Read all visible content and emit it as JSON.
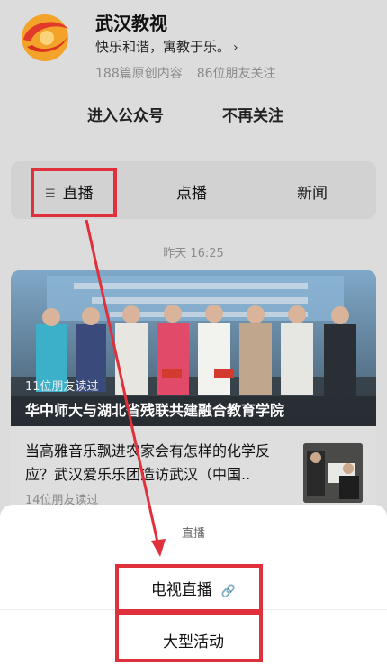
{
  "account": {
    "name": "武汉教视",
    "description": "快乐和谐，寓教于乐。",
    "description_chevron": "›",
    "stats": [
      "188篇原创内容",
      "86位朋友关注"
    ],
    "actions": {
      "enter": "进入公众号",
      "unfollow": "不再关注"
    }
  },
  "tabs": [
    {
      "label": "直播",
      "icon": "menu-icon"
    },
    {
      "label": "点播"
    },
    {
      "label": "新闻"
    }
  ],
  "feed": {
    "timestamp": "昨天 16:25",
    "featured": {
      "readers": "11位朋友读过",
      "title": "华中师大与湖北省残联共建融合教育学院"
    },
    "article": {
      "title": "当高雅音乐飘进农家会有怎样的化学反应？武汉爱乐乐团造访武汉（中国..",
      "readers": "14位朋友读过"
    }
  },
  "sheet": {
    "title": "直播",
    "items": [
      {
        "label": "电视直播",
        "icon": "link-icon"
      },
      {
        "label": "大型活动"
      }
    ]
  },
  "colors": {
    "highlight": "#e0303c",
    "logo_orange": "#f39a1f",
    "logo_red": "#e23a2a"
  }
}
